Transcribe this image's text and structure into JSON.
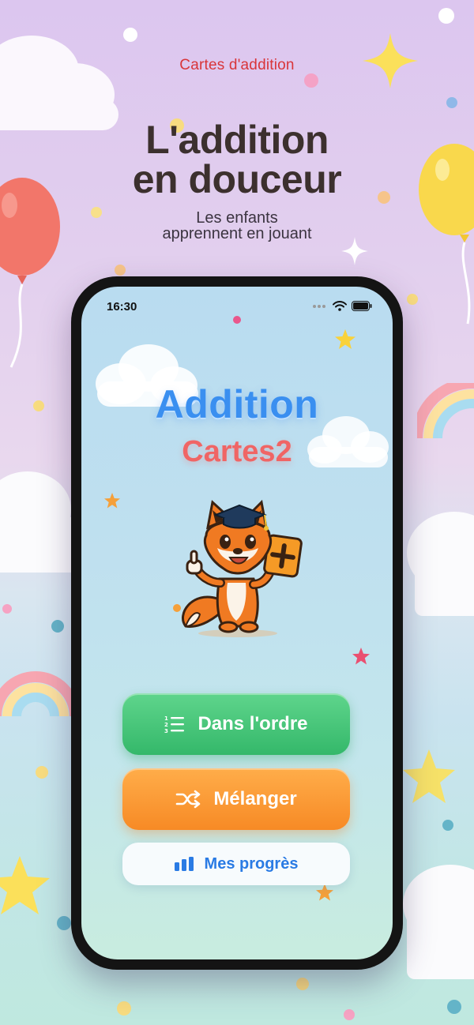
{
  "promo": {
    "eyebrow": "Cartes d'addition",
    "headline_line1": "L'addition",
    "headline_line2": "en douceur",
    "subline_line1": "Les enfants",
    "subline_line2": "apprennent en jouant"
  },
  "status_bar": {
    "time": "16:30",
    "icons": [
      "signal-dots-icon",
      "wifi-icon",
      "battery-icon"
    ]
  },
  "app": {
    "title": "Addition",
    "subtitle": "Cartes2",
    "mascot": "fox-mascot-with-plus-card",
    "buttons": {
      "in_order": {
        "label": "Dans l'ordre",
        "icon": "numbered-list-icon",
        "color": "#3cc073"
      },
      "shuffle": {
        "label": "Mélanger",
        "icon": "shuffle-icon",
        "color": "#f99733"
      },
      "progress": {
        "label": "Mes progrès",
        "icon": "bar-chart-icon",
        "color": "#2a7be4"
      }
    }
  },
  "colors": {
    "eyebrow": "#d9353a",
    "headline": "#3c302e",
    "title_blue": "#3a8ff0",
    "subtitle_red": "#f06565"
  }
}
